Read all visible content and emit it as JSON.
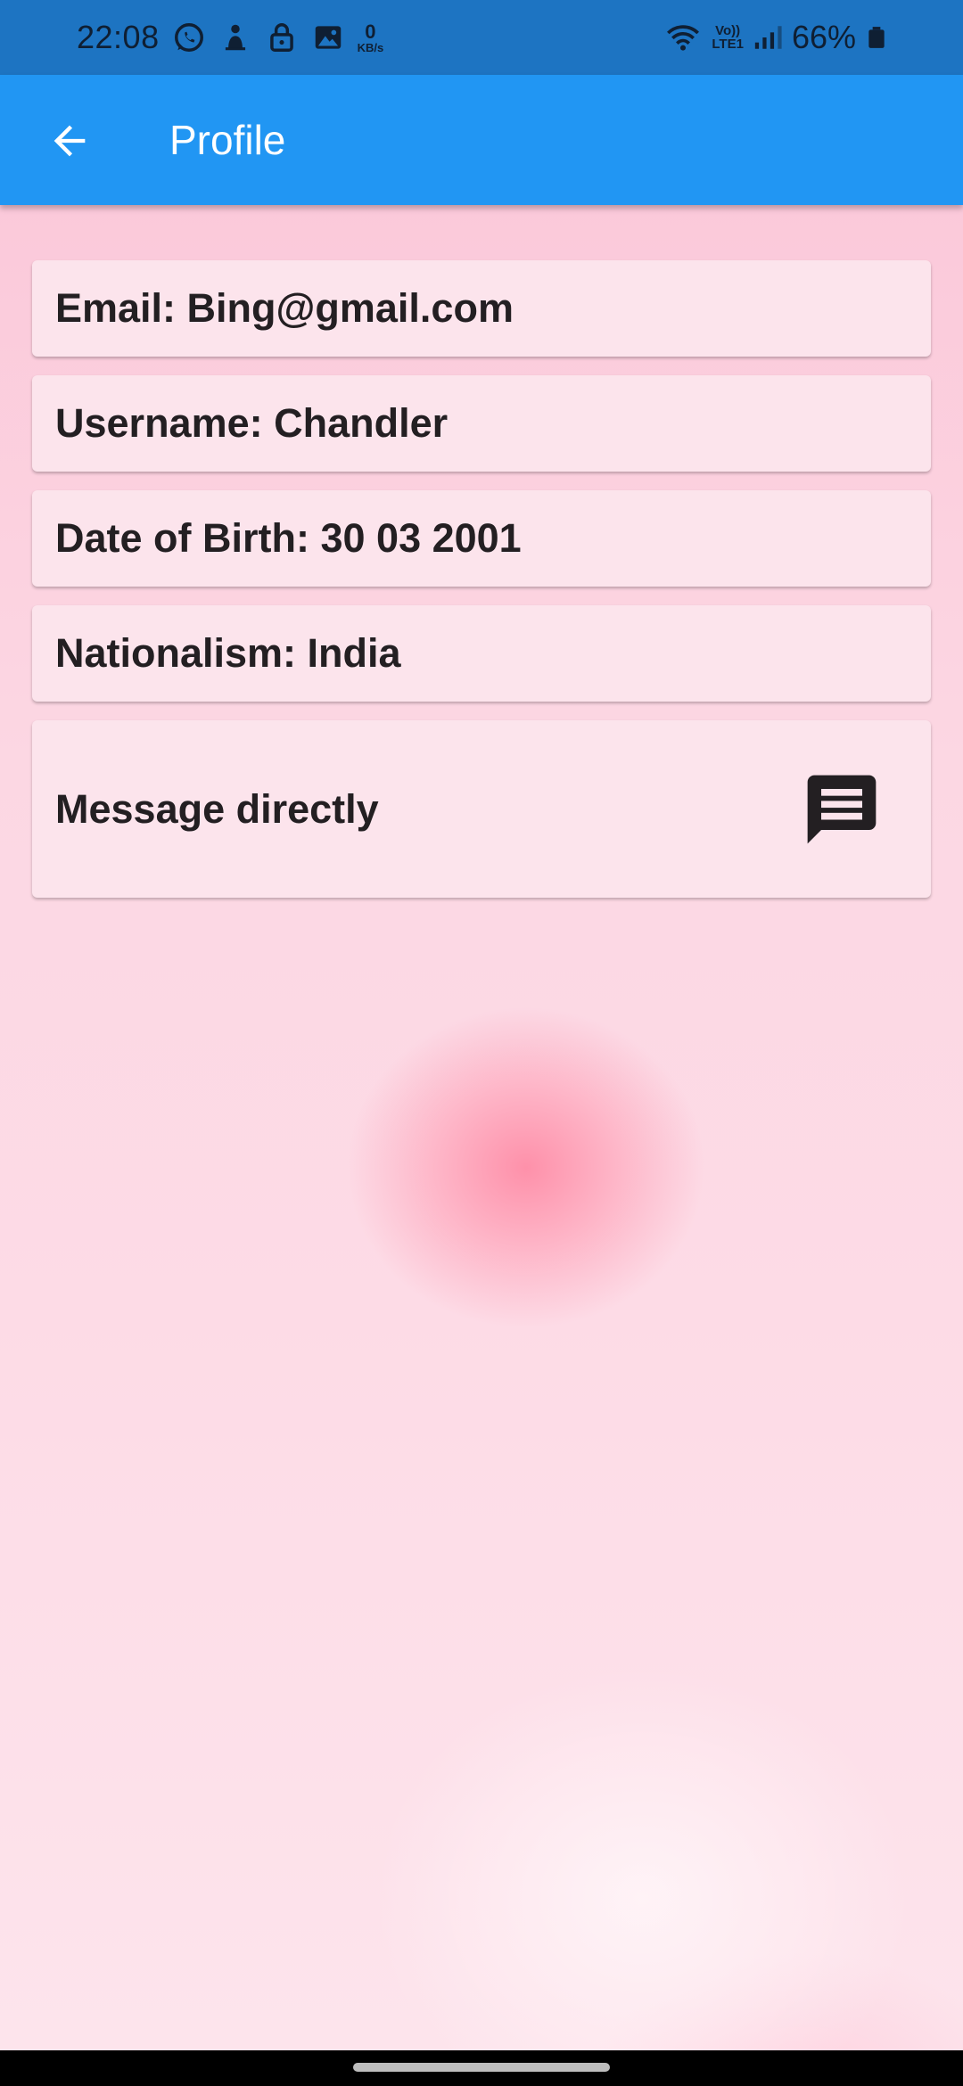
{
  "status_bar": {
    "time": "22:08",
    "data_speed_value": "0",
    "data_speed_unit": "KB/s",
    "network_top": "Vo))",
    "network_bottom": "LTE1",
    "battery_percent": "66%",
    "icons": [
      "whatsapp-icon",
      "notification-icon",
      "lock-icon",
      "gallery-icon",
      "wifi-icon",
      "signal-icon",
      "battery-icon"
    ]
  },
  "app_bar": {
    "title": "Profile",
    "back_icon": "arrow-back-icon",
    "background": "#2196f3"
  },
  "profile": {
    "email": "Email: Bing@gmail.com",
    "username": "Username: Chandler",
    "dob": "Date of Birth: 30 03 2001",
    "nationalism": "Nationalism: India",
    "message_label": "Message directly",
    "message_icon": "chat-icon"
  },
  "colors": {
    "status_bar": "#1d74c2",
    "card": "#fce4ec",
    "text": "#231f22"
  }
}
